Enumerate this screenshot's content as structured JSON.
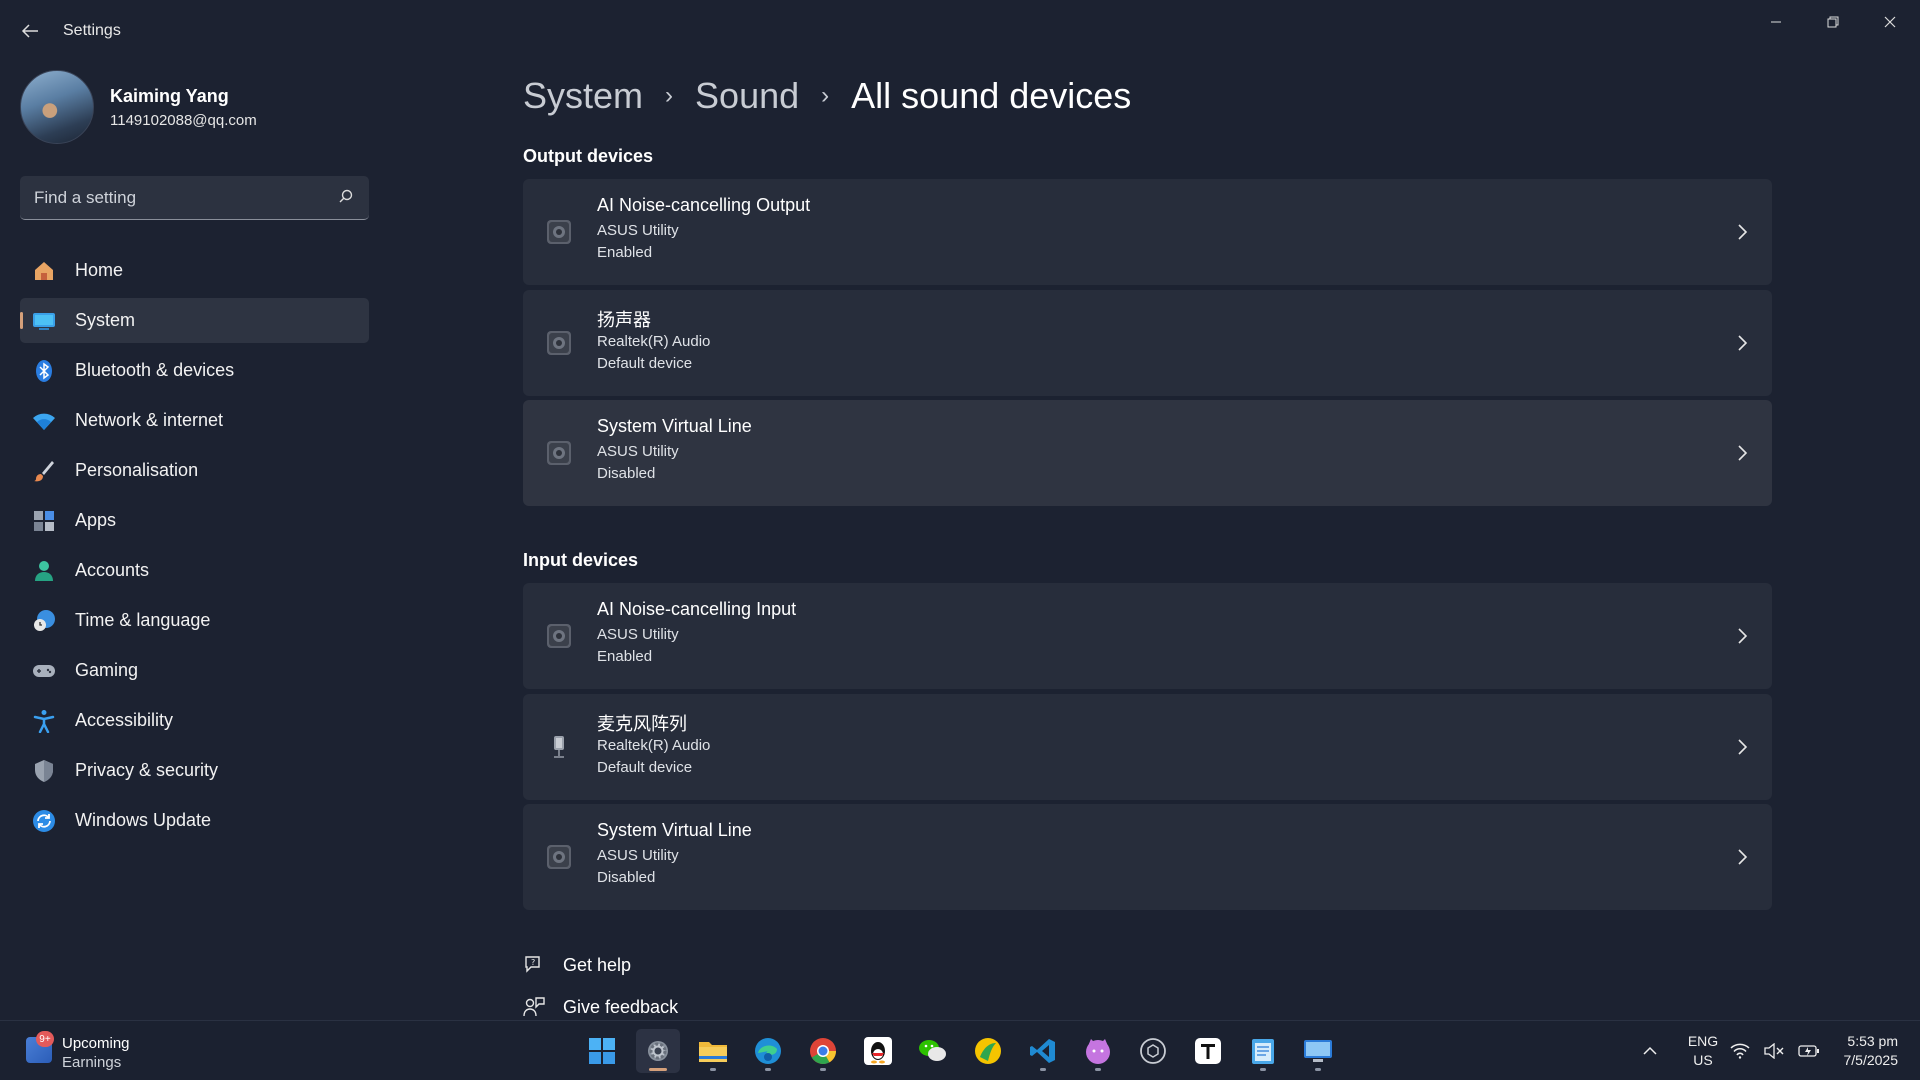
{
  "window": {
    "title": "Settings"
  },
  "profile": {
    "name": "Kaiming Yang",
    "email": "1149102088@qq.com"
  },
  "search": {
    "placeholder": "Find a setting"
  },
  "sidebar": {
    "items": [
      {
        "label": "Home",
        "icon": "home-icon"
      },
      {
        "label": "System",
        "icon": "system-icon",
        "active": true
      },
      {
        "label": "Bluetooth & devices",
        "icon": "bluetooth-icon"
      },
      {
        "label": "Network & internet",
        "icon": "wifi-icon"
      },
      {
        "label": "Personalisation",
        "icon": "brush-icon"
      },
      {
        "label": "Apps",
        "icon": "apps-icon"
      },
      {
        "label": "Accounts",
        "icon": "account-icon"
      },
      {
        "label": "Time & language",
        "icon": "clock-globe-icon"
      },
      {
        "label": "Gaming",
        "icon": "gamepad-icon"
      },
      {
        "label": "Accessibility",
        "icon": "accessibility-icon"
      },
      {
        "label": "Privacy & security",
        "icon": "shield-icon"
      },
      {
        "label": "Windows Update",
        "icon": "update-icon"
      }
    ]
  },
  "breadcrumb": {
    "items": [
      "System",
      "Sound",
      "All sound devices"
    ]
  },
  "output_section": {
    "title": "Output devices",
    "devices": [
      {
        "name": "AI Noise-cancelling Output",
        "vendor": "ASUS Utility",
        "status": "Enabled",
        "icon": "speaker-icon"
      },
      {
        "name": "扬声器",
        "vendor": "Realtek(R) Audio",
        "status": "Default device",
        "icon": "speaker-icon"
      },
      {
        "name": "System Virtual Line",
        "vendor": "ASUS Utility",
        "status": "Disabled",
        "icon": "speaker-icon"
      }
    ]
  },
  "input_section": {
    "title": "Input devices",
    "devices": [
      {
        "name": "AI Noise-cancelling Input",
        "vendor": "ASUS Utility",
        "status": "Enabled",
        "icon": "speaker-icon"
      },
      {
        "name": "麦克风阵列",
        "vendor": "Realtek(R) Audio",
        "status": "Default device",
        "icon": "microphone-icon"
      },
      {
        "name": "System Virtual Line",
        "vendor": "ASUS Utility",
        "status": "Disabled",
        "icon": "speaker-icon"
      }
    ]
  },
  "help": {
    "get_help": "Get help",
    "give_feedback": "Give feedback"
  },
  "taskbar": {
    "widget": {
      "badge": "9+",
      "title": "Upcoming",
      "subtitle": "Earnings"
    },
    "apps": [
      "start-icon",
      "settings-icon",
      "file-explorer-icon",
      "edge-icon",
      "chrome-icon",
      "qq-icon",
      "wechat-icon",
      "app-icon",
      "vscode-icon",
      "cat-app-icon",
      "openai-icon",
      "typora-icon",
      "notepad-icon",
      "remote-desktop-icon"
    ],
    "lang": {
      "line1": "ENG",
      "line2": "US"
    },
    "clock": {
      "time": "5:53 pm",
      "date": "7/5/2025"
    }
  },
  "colors": {
    "background": "#1c2231",
    "card": "#272d3b",
    "accent": "#d5a07a"
  }
}
